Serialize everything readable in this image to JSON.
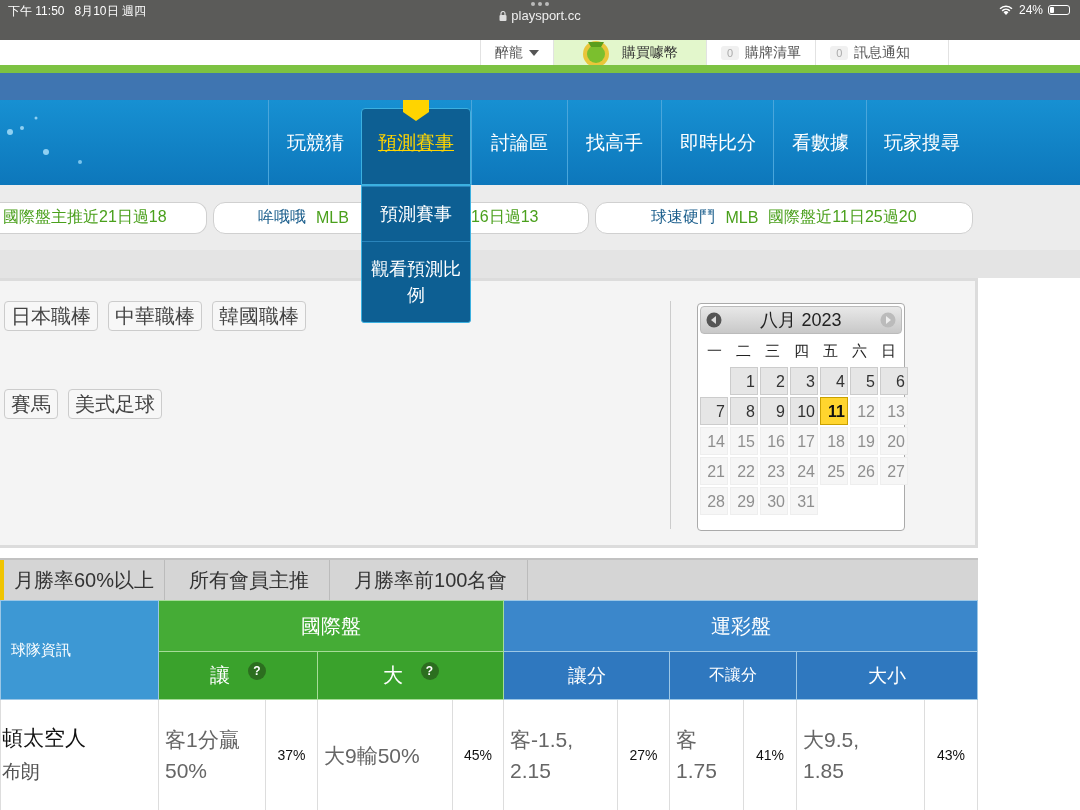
{
  "status_bar": {
    "time": "下午 11:50",
    "date": "8月10日 週四",
    "url": "playsport.cc",
    "battery": "24%"
  },
  "user_bar": [
    {
      "kind": "user",
      "label": "醉龍"
    },
    {
      "kind": "coins",
      "label": "購買噱幣"
    },
    {
      "kind": "counter",
      "count": "0",
      "label": "購牌清單"
    },
    {
      "kind": "counter",
      "count": "0",
      "label": "訊息通知"
    }
  ],
  "nav": {
    "items": [
      {
        "label": "玩競猜",
        "selected": false
      },
      {
        "label": "預測賽事",
        "selected": true
      },
      {
        "label": "討論區",
        "selected": false
      },
      {
        "label": "找高手",
        "selected": false
      },
      {
        "label": "即時比分",
        "selected": false
      },
      {
        "label": "看數據",
        "selected": false
      },
      {
        "label": "玩家搜尋",
        "selected": false
      }
    ],
    "dropdown": [
      "預測賽事",
      "觀看預測比例"
    ]
  },
  "ticker": [
    {
      "parts": [
        {
          "kind": "record",
          "text": "國際盤主推近21日過18"
        }
      ]
    },
    {
      "parts": [
        {
          "kind": "name",
          "text": "哞哦哦"
        },
        {
          "kind": "record",
          "text": "MLB"
        },
        {
          "kind": "hidden-gap",
          "text": "16日過13"
        }
      ]
    },
    {
      "parts": [
        {
          "kind": "name",
          "text": "球速硬鬥"
        },
        {
          "kind": "record",
          "text": "MLB"
        },
        {
          "kind": "record",
          "text": "國際盤近11日25過20"
        }
      ]
    }
  ],
  "sport_rows": [
    [
      "日本職棒",
      "中華職棒",
      "韓國職棒"
    ],
    [],
    [
      "賽馬",
      "美式足球"
    ]
  ],
  "calendar": {
    "title": "八月 2023",
    "weekdays": [
      "一",
      "二",
      "三",
      "四",
      "五",
      "六",
      "日"
    ],
    "weeks": [
      [
        {
          "day": "1",
          "disabled": false,
          "selected": false
        },
        {
          "day": "2",
          "disabled": false,
          "selected": false
        },
        {
          "day": "3",
          "disabled": false,
          "selected": false
        },
        {
          "day": "4",
          "disabled": false,
          "selected": false
        },
        {
          "day": "5",
          "disabled": false,
          "selected": false
        },
        {
          "day": "6",
          "disabled": false,
          "selected": false
        }
      ],
      [
        {
          "day": "7",
          "disabled": false,
          "selected": false
        },
        {
          "day": "8",
          "disabled": false,
          "selected": false
        },
        {
          "day": "9",
          "disabled": false,
          "selected": false
        },
        {
          "day": "10",
          "disabled": false,
          "selected": false
        },
        {
          "day": "11",
          "disabled": false,
          "selected": true
        },
        {
          "day": "12",
          "disabled": true,
          "selected": false
        },
        {
          "day": "13",
          "disabled": true,
          "selected": false
        }
      ],
      [
        {
          "day": "14",
          "disabled": true,
          "selected": false
        },
        {
          "day": "15",
          "disabled": true,
          "selected": false
        },
        {
          "day": "16",
          "disabled": true,
          "selected": false
        },
        {
          "day": "17",
          "disabled": true,
          "selected": false
        },
        {
          "day": "18",
          "disabled": true,
          "selected": false
        },
        {
          "day": "19",
          "disabled": true,
          "selected": false
        },
        {
          "day": "20",
          "disabled": true,
          "selected": false
        }
      ],
      [
        {
          "day": "21",
          "disabled": true,
          "selected": false
        },
        {
          "day": "22",
          "disabled": true,
          "selected": false
        },
        {
          "day": "23",
          "disabled": true,
          "selected": false
        },
        {
          "day": "24",
          "disabled": true,
          "selected": false
        },
        {
          "day": "25",
          "disabled": true,
          "selected": false
        },
        {
          "day": "26",
          "disabled": true,
          "selected": false
        },
        {
          "day": "27",
          "disabled": true,
          "selected": false
        }
      ],
      [
        {
          "day": "28",
          "disabled": true,
          "selected": false
        },
        {
          "day": "29",
          "disabled": true,
          "selected": false
        },
        {
          "day": "30",
          "disabled": true,
          "selected": false
        },
        {
          "day": "31",
          "disabled": true,
          "selected": false
        }
      ]
    ]
  },
  "tabs": [
    {
      "label": "月勝率60%以上",
      "selected": true
    },
    {
      "label": "所有會員主推",
      "selected": false
    },
    {
      "label": "月勝率前100名會",
      "selected": false
    }
  ],
  "table": {
    "team_header": "球隊資訊",
    "groups": [
      {
        "label": "國際盤",
        "kind": "intl",
        "columns": [
          {
            "label": "讓",
            "help": "?"
          },
          {
            "label": "大",
            "help": "?"
          }
        ]
      },
      {
        "label": "運彩盤",
        "kind": "sport",
        "columns": [
          {
            "label": "讓分"
          },
          {
            "label": "不讓分"
          },
          {
            "label": "大小"
          }
        ]
      }
    ],
    "rows": [
      {
        "team": "頓太空人",
        "pitcher": "布朗",
        "cells": [
          {
            "value": "客1分贏\n50%",
            "pct": "37%"
          },
          {
            "value": "大9輸50%",
            "pct": "45%"
          },
          {
            "value": "客-1.5,\n2.15",
            "pct": "27%"
          },
          {
            "value": "客\n1.75",
            "pct": "41%"
          },
          {
            "value": "大9.5,\n1.85",
            "pct": "43%"
          }
        ]
      }
    ]
  }
}
